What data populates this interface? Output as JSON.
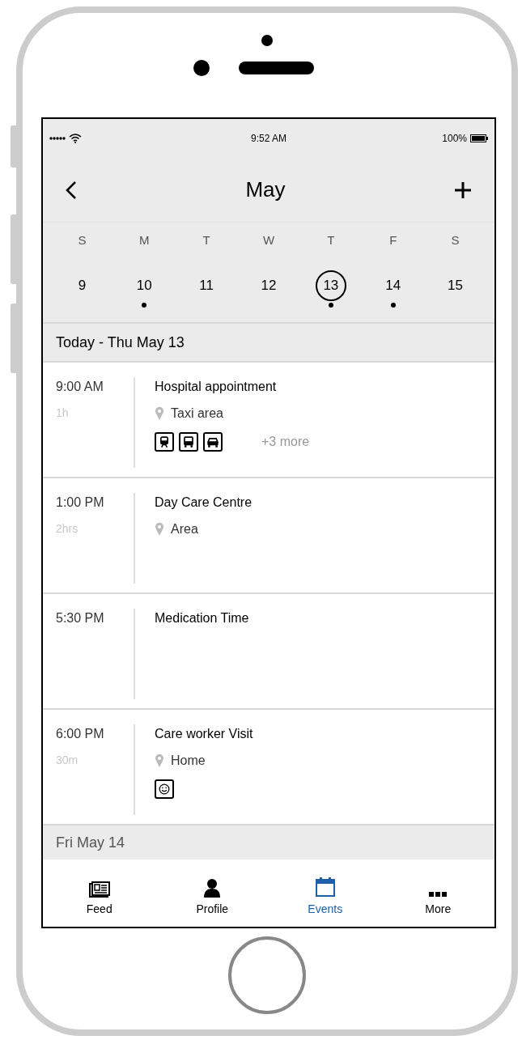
{
  "status_bar": {
    "time": "9:52 AM",
    "battery": "100%"
  },
  "header": {
    "title": "May"
  },
  "weekdays": [
    "S",
    "M",
    "T",
    "W",
    "T",
    "F",
    "S"
  ],
  "dates": [
    {
      "label": "9",
      "selected": false,
      "has_events": false
    },
    {
      "label": "10",
      "selected": false,
      "has_events": true
    },
    {
      "label": "11",
      "selected": false,
      "has_events": false
    },
    {
      "label": "12",
      "selected": false,
      "has_events": false
    },
    {
      "label": "13",
      "selected": true,
      "has_events": true
    },
    {
      "label": "14",
      "selected": false,
      "has_events": true
    },
    {
      "label": "15",
      "selected": false,
      "has_events": false
    }
  ],
  "today_header": "Today - Thu May 13",
  "events": [
    {
      "time": "9:00 AM",
      "duration": "1h",
      "title": "Hospital appointment",
      "location": "Taxi area",
      "icons": [
        {
          "kind": "train"
        },
        {
          "kind": "bus"
        },
        {
          "kind": "car"
        }
      ],
      "more": "+3 more"
    },
    {
      "time": "1:00 PM",
      "duration": "2hrs",
      "title": "Day Care Centre",
      "location": "Area"
    },
    {
      "time": "5:30 PM",
      "title": "Medication Time"
    },
    {
      "time": "6:00 PM",
      "duration": "30m",
      "title": "Care worker Visit",
      "location": "Home",
      "icons": [
        {
          "kind": "smiley"
        }
      ]
    }
  ],
  "next_header": "Fri May 14",
  "tabs": [
    {
      "label": "Feed",
      "selected": false
    },
    {
      "label": "Profile",
      "selected": false
    },
    {
      "label": "Events",
      "selected": true
    },
    {
      "label": "More",
      "selected": false
    }
  ]
}
